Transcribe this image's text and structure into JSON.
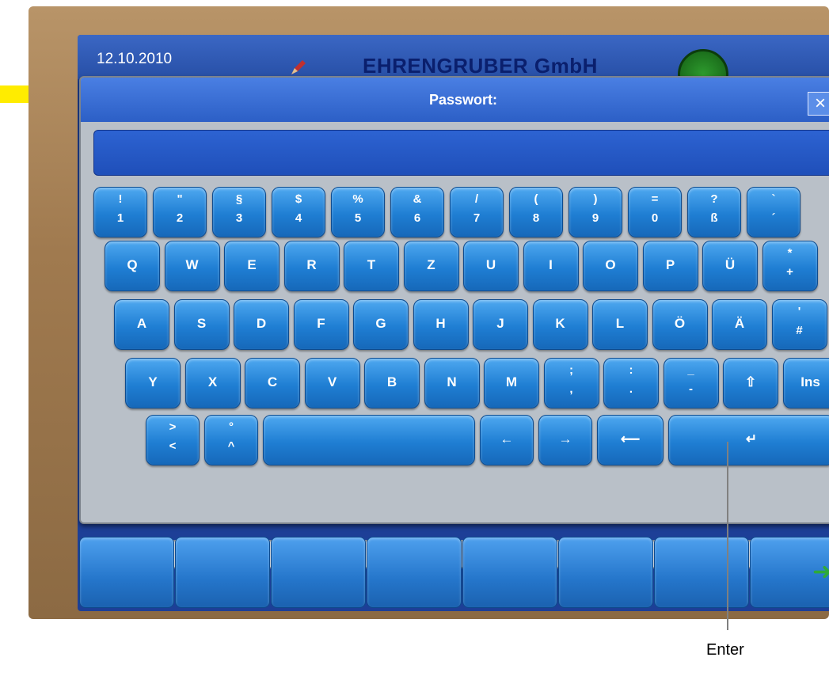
{
  "header": {
    "date": "12.10.2010",
    "brand": "EHRENGRUBER GmbH"
  },
  "dialog": {
    "title": "Passwort:",
    "close": "×"
  },
  "keyboard": {
    "row1": [
      {
        "top": "!",
        "bottom": "1"
      },
      {
        "top": "\"",
        "bottom": "2"
      },
      {
        "top": "§",
        "bottom": "3"
      },
      {
        "top": "$",
        "bottom": "4"
      },
      {
        "top": "%",
        "bottom": "5"
      },
      {
        "top": "&",
        "bottom": "6"
      },
      {
        "top": "/",
        "bottom": "7"
      },
      {
        "top": "(",
        "bottom": "8"
      },
      {
        "top": ")",
        "bottom": "9"
      },
      {
        "top": "=",
        "bottom": "0"
      },
      {
        "top": "?",
        "bottom": "ß"
      },
      {
        "top": "`",
        "bottom": "´"
      }
    ],
    "row2": [
      "Q",
      "W",
      "E",
      "R",
      "T",
      "Z",
      "U",
      "I",
      "O",
      "P",
      "Ü"
    ],
    "row2_last": {
      "top": "*",
      "bottom": "+"
    },
    "row3": [
      "A",
      "S",
      "D",
      "F",
      "G",
      "H",
      "J",
      "K",
      "L",
      "Ö",
      "Ä"
    ],
    "row3_last": {
      "top": "'",
      "bottom": "#"
    },
    "row4": [
      "Y",
      "X",
      "C",
      "V",
      "B",
      "N",
      "M"
    ],
    "row4_punct": [
      {
        "top": ";",
        "bottom": ","
      },
      {
        "top": ":",
        "bottom": "."
      },
      {
        "top": "_",
        "bottom": "-"
      }
    ],
    "shift": "⇧",
    "ins": "Ins",
    "row5_left": [
      {
        "top": ">",
        "bottom": "<"
      },
      {
        "top": "°",
        "bottom": "^"
      }
    ],
    "left": "←",
    "right": "→",
    "backspace": "⟵",
    "enter": "↵"
  },
  "fkeys_action": "➜",
  "callout": "Enter",
  "colors": {
    "accent_arrow": "#ffec00",
    "key": "#1f7ed3",
    "screen": "#1d3f97"
  }
}
